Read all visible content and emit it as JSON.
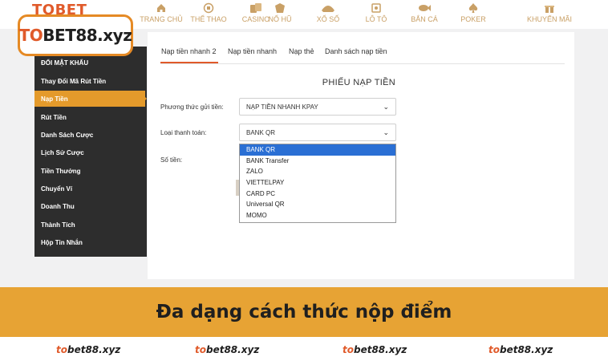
{
  "header": {
    "brand_strip": "TOBET",
    "nav": [
      {
        "label": "TRANG CHỦ",
        "icon": "home-icon"
      },
      {
        "label": "THỂ THAO",
        "icon": "sports-icon"
      },
      {
        "label": "CASINO",
        "icon": "casino-icon"
      },
      {
        "label": "NỔ HŨ",
        "icon": "slot-icon"
      },
      {
        "label": "XỔ SỐ",
        "icon": "lottery-icon"
      },
      {
        "label": "LÔ TÔ",
        "icon": "lotto-icon"
      },
      {
        "label": "BẮN CÁ",
        "icon": "fish-icon"
      },
      {
        "label": "POKER",
        "icon": "spade-icon"
      },
      {
        "label": "KHUYẾN MÃI",
        "icon": "gift-icon"
      }
    ]
  },
  "logo": {
    "text_to": "TO",
    "text_bet": "BET88.xyz",
    "color_to": "#e05a2a",
    "color_rest": "#1f1f1f",
    "border_color": "#e58a25"
  },
  "sidebar": {
    "items": [
      {
        "label": "ĐỔI MẬT KHẨU"
      },
      {
        "label": "Thay Đổi Mã Rút Tiền"
      },
      {
        "label": "Nạp Tiền",
        "active": true
      },
      {
        "label": "Rút Tiền"
      },
      {
        "label": "Danh Sách Cược"
      },
      {
        "label": "Lịch Sử Cược"
      },
      {
        "label": "Tiền Thưởng"
      },
      {
        "label": "Chuyển Ví"
      },
      {
        "label": "Doanh Thu"
      },
      {
        "label": "Thành Tích"
      },
      {
        "label": "Hộp Tin Nhắn"
      }
    ],
    "active_color": "#e49a2b"
  },
  "tabs": [
    {
      "label": "Nạp tiền nhanh 2",
      "active": true
    },
    {
      "label": "Nạp tiền nhanh"
    },
    {
      "label": "Nạp thẻ"
    },
    {
      "label": "Danh sách nạp tiền"
    }
  ],
  "form": {
    "title": "PHIẾU NẠP TIỀN",
    "method_label": "Phương thức gửi tiền:",
    "method_value": "NẠP TIỀN NHANH KPAY",
    "type_label": "Loại thanh toán:",
    "type_value": "BANK QR",
    "amount_label": "Số tiền:",
    "options": [
      "BANK QR",
      "BANK Transfer",
      "ZALO",
      "VIETTELPAY",
      "CARD PC",
      "Universal QR",
      "MOMO"
    ],
    "selected_option": "BANK QR",
    "highlight_color": "#2a6fd4"
  },
  "banner": {
    "text": "Đa dạng cách thức nộp điểm",
    "color": "#e7a334"
  },
  "footer": {
    "items": [
      {
        "to": "to",
        "rest": "bet88.xyz"
      },
      {
        "to": "to",
        "rest": "bet88.xyz"
      },
      {
        "to": "to",
        "rest": "bet88.xyz"
      },
      {
        "to": "to",
        "rest": "bet88.xyz"
      }
    ]
  }
}
